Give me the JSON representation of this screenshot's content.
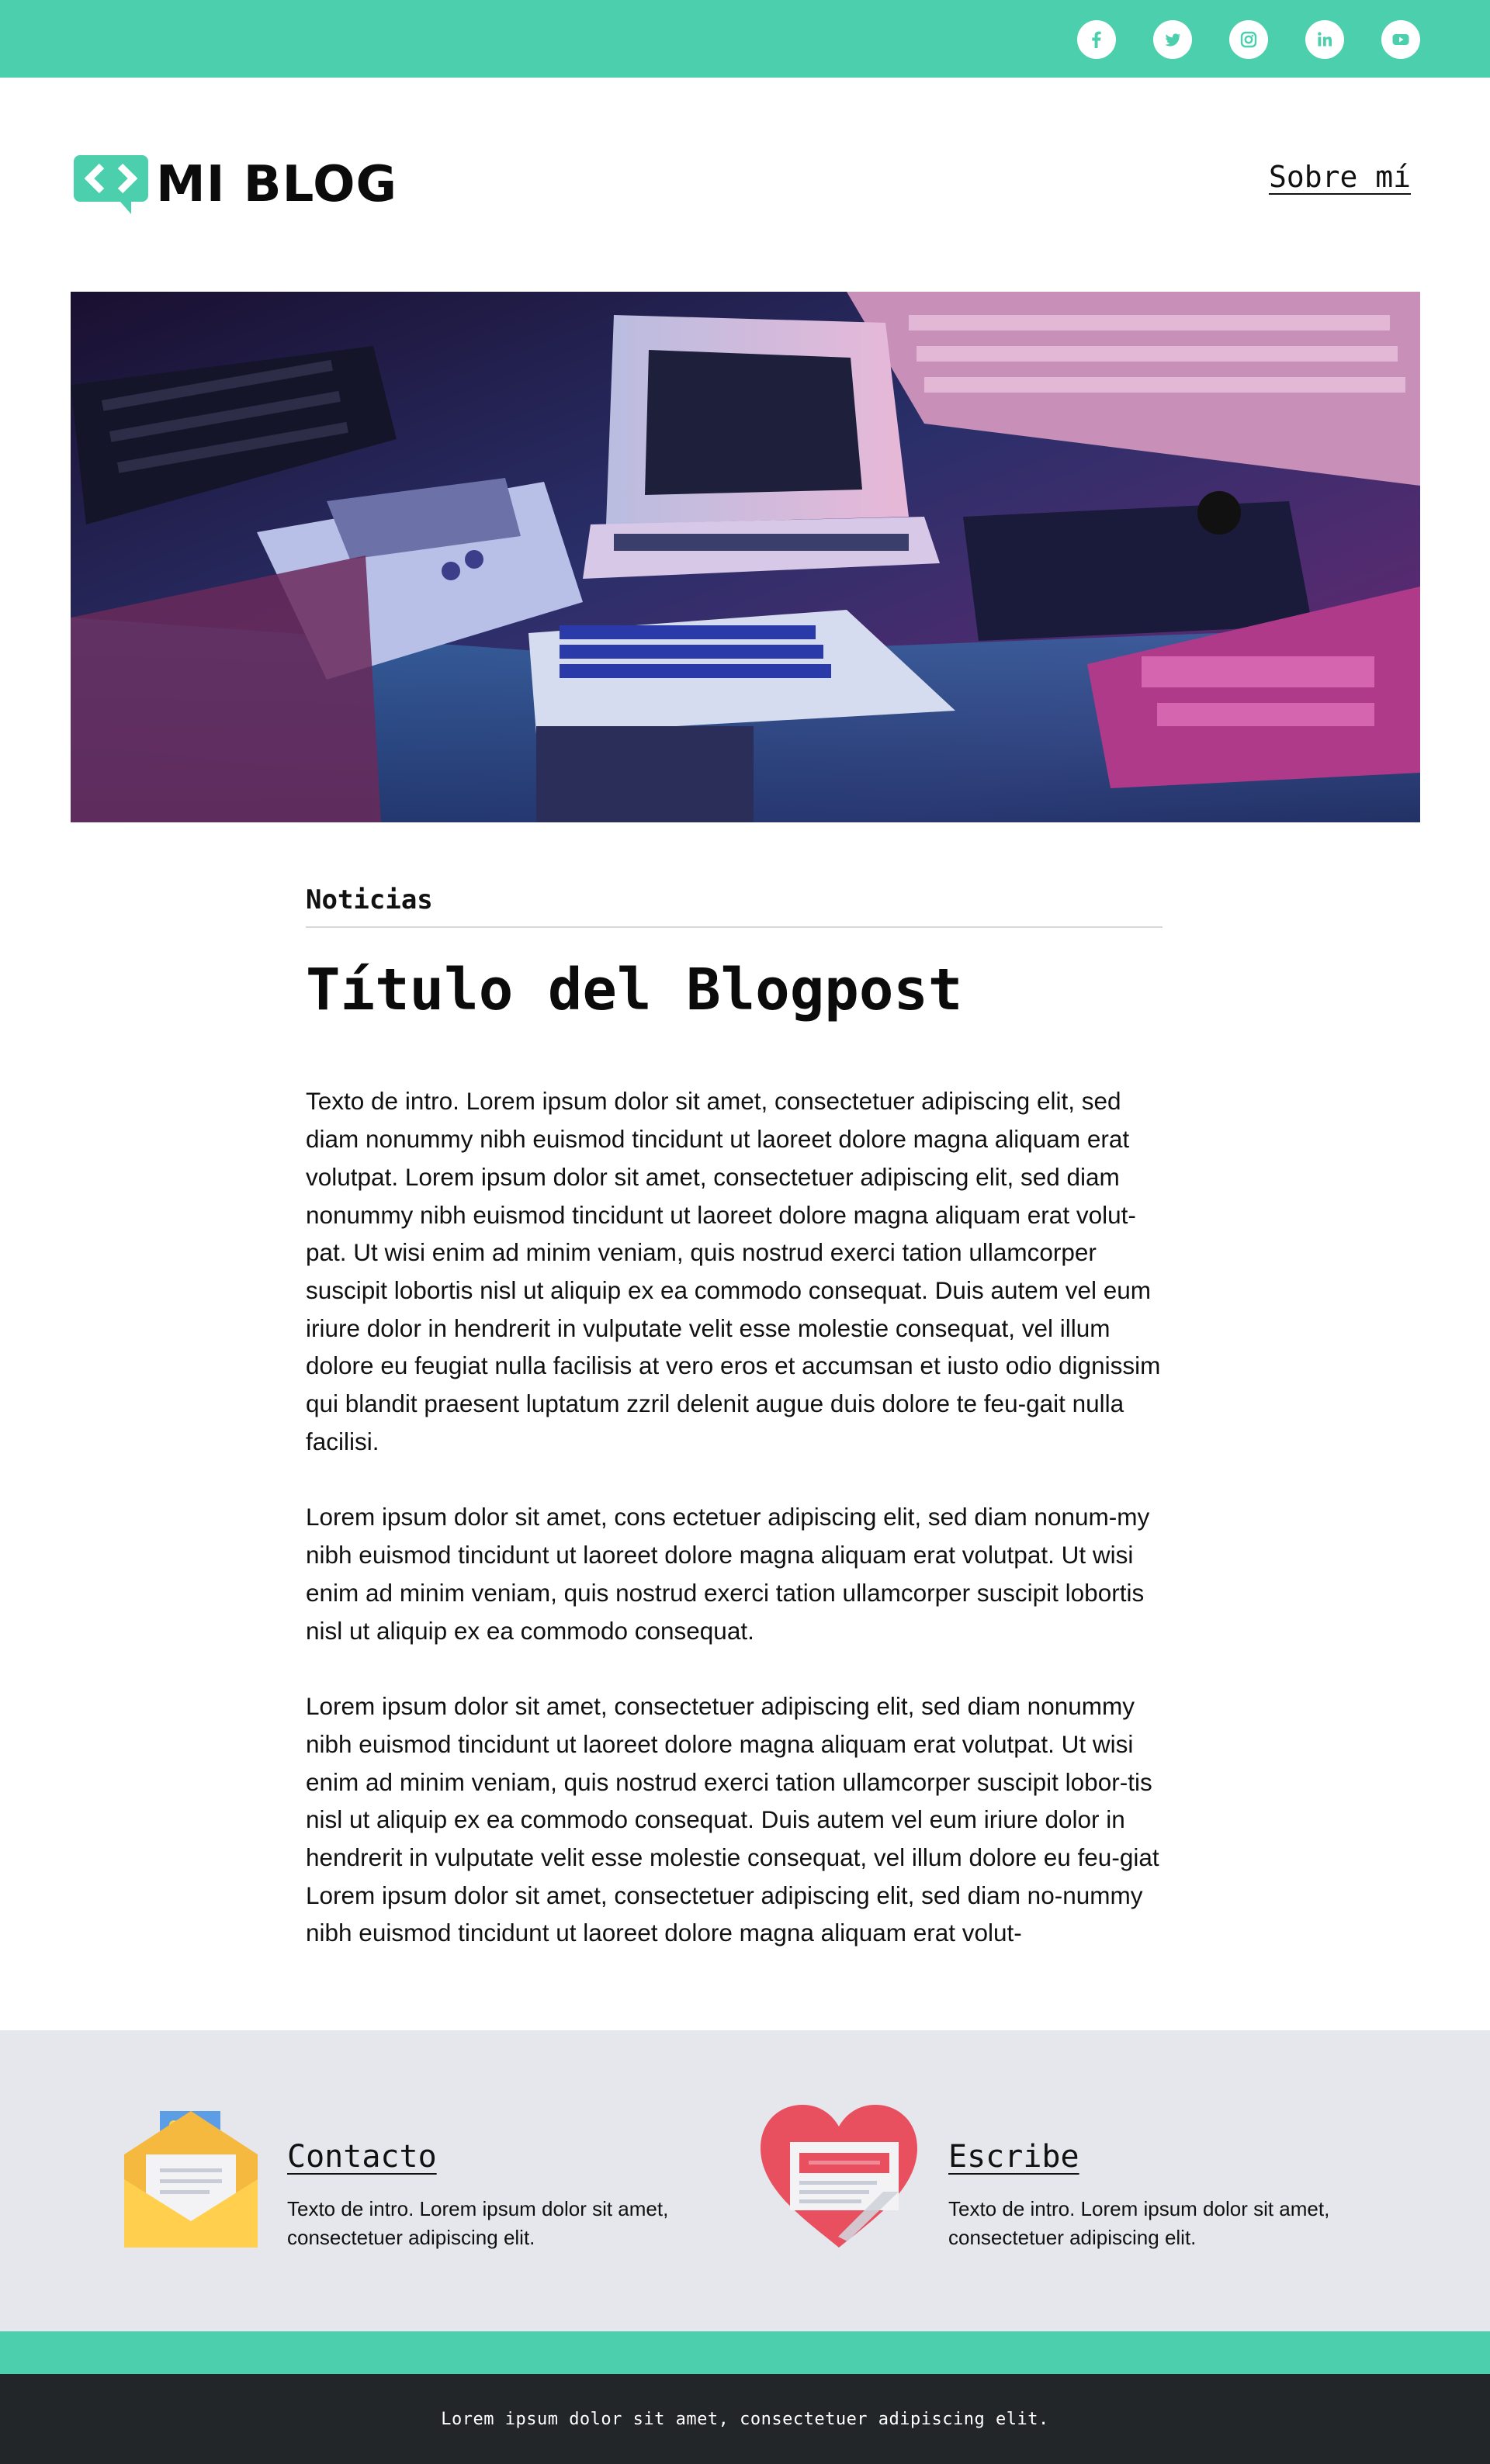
{
  "social": [
    {
      "icon": "facebook-icon"
    },
    {
      "icon": "twitter-icon"
    },
    {
      "icon": "instagram-icon"
    },
    {
      "icon": "linkedin-icon"
    },
    {
      "icon": "youtube-icon"
    }
  ],
  "header": {
    "logo_text": "MI BLOG",
    "nav_about": "Sobre mí"
  },
  "article": {
    "category": "Noticias",
    "title": "Título del Blogpost",
    "paragraphs": [
      "Texto de intro. Lorem ipsum dolor sit amet, consectetuer adipiscing elit, sed diam nonummy nibh euismod tincidunt ut laoreet dolore magna aliquam erat volutpat. Lorem ipsum dolor sit amet, consectetuer adipiscing elit, sed diam nonummy nibh euismod tincidunt ut laoreet dolore magna aliquam erat volut-pat. Ut wisi enim ad minim veniam, quis nostrud exerci tation ullamcorper suscipit lobortis nisl ut aliquip ex ea commodo consequat. Duis autem vel eum iriure dolor in hendrerit in vulputate velit esse molestie consequat, vel illum dolore eu feugiat nulla facilisis at vero eros et accumsan et iusto odio dignissim qui blandit praesent luptatum zzril delenit augue duis dolore te feu-gait nulla facilisi.",
      "Lorem ipsum dolor sit amet, cons ectetuer adipiscing elit, sed diam nonum-my nibh euismod tincidunt ut laoreet dolore magna aliquam erat volutpat. Ut wisi enim ad minim veniam, quis nostrud exerci tation ullamcorper suscipit lobortis nisl ut aliquip ex ea commodo consequat.",
      "Lorem ipsum dolor sit amet, consectetuer adipiscing elit, sed diam nonummy nibh euismod tincidunt ut laoreet dolore magna aliquam erat volutpat. Ut wisi enim ad minim veniam, quis nostrud exerci tation ullamcorper suscipit lobor-tis nisl ut aliquip ex ea commodo consequat. Duis autem vel eum iriure dolor in hendrerit in vulputate velit esse molestie consequat, vel illum dolore eu feu-giat Lorem ipsum dolor sit amet, consectetuer adipiscing elit, sed diam no-nummy nibh euismod tincidunt ut laoreet dolore magna aliquam erat volut-"
    ]
  },
  "cards": [
    {
      "icon": "envelope-icon",
      "title": "Contacto",
      "text": "Texto de intro. Lorem ipsum dolor sit amet, consectetuer adipiscing elit."
    },
    {
      "icon": "heart-letter-icon",
      "title": "Escribe",
      "text": "Texto de intro. Lorem ipsum dolor sit amet, consectetuer adipiscing elit."
    }
  ],
  "footer": {
    "text": "Lorem ipsum dolor sit amet, consectetuer adipiscing elit."
  },
  "colors": {
    "accent": "#4bcfad",
    "contact_bg": "#e5e7ec",
    "footer_bg": "#232629"
  }
}
